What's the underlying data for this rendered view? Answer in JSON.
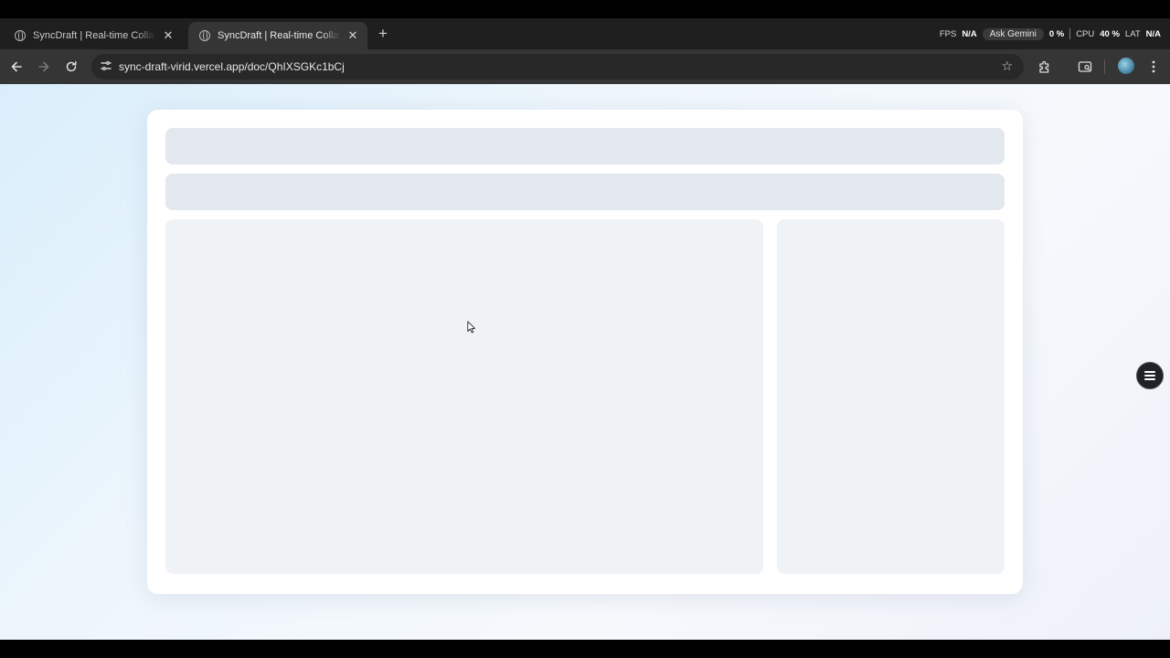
{
  "browser": {
    "tabs": [
      {
        "title": "SyncDraft | Real-time Collaborative Editor",
        "active": false
      },
      {
        "title": "SyncDraft | Real-time Collaborative Editor",
        "active": true
      }
    ],
    "new_tab_label": "+",
    "url": "sync-draft-virid.vercel.app/doc/QhIXSGKc1bCj",
    "overlay": {
      "gemini_label": "Ask Gemini",
      "fps_label": "FPS",
      "fps_value": "N/A",
      "gpu_value": "0 %",
      "cpu_label": "CPU",
      "cpu_value": "40 %",
      "lat_label": "LAT",
      "lat_value": "N/A"
    }
  },
  "icons": {
    "back": "back-arrow-icon",
    "forward": "forward-arrow-icon",
    "reload": "reload-icon",
    "site_info": "tune-icon",
    "bookmark": "star-icon",
    "extensions": "puzzle-icon",
    "cast": "cast-icon",
    "profile": "avatar",
    "menu": "kebab-menu-icon",
    "floating": "menu-lines-icon"
  },
  "page": {
    "state": "loading-skeleton"
  }
}
